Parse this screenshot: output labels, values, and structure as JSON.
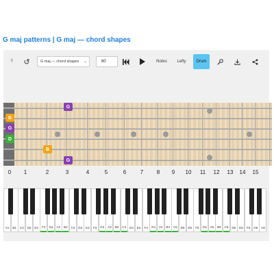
{
  "header": {
    "title": "G maj patterns | G maj — chord shapes"
  },
  "toolbar": {
    "help_label": "?",
    "select_value": "G maj — chord shapes",
    "tempo_value": "80",
    "notes_label": "Notes",
    "lefty_label": "Lefty",
    "drum_label": "Drum",
    "accent_color": "#5bc4f0"
  },
  "fretboard": {
    "fret_numbers": [
      "0",
      "1",
      "2",
      "3",
      "4",
      "5",
      "6",
      "7",
      "8",
      "9",
      "10",
      "11",
      "12",
      "13",
      "14",
      "15"
    ],
    "notes": [
      {
        "label": "G",
        "color": "#8a3fb0"
      },
      {
        "label": "B",
        "color": "#f2a416"
      },
      {
        "label": "G",
        "color": "#8a3fb0"
      },
      {
        "label": "D",
        "color": "#3bb03b"
      },
      {
        "label": "B",
        "color": "#f2a416"
      },
      {
        "label": "G",
        "color": "#8a3fb0"
      }
    ]
  },
  "keyboard": {
    "highlight_color": "#3bb03b",
    "white_keys": [
      "A1",
      "B1",
      "C2",
      "D2",
      "E2",
      "F2",
      "G2",
      "A2",
      "B2",
      "C3",
      "D3",
      "E3",
      "F3",
      "G3",
      "A3",
      "B3",
      "C4",
      "D4",
      "E4",
      "F4",
      "G4",
      "A4",
      "B4",
      "C5",
      "D5",
      "E5",
      "F5",
      "G5",
      "A5",
      "B5",
      "C6",
      "D6",
      "E6",
      "F6",
      "G6",
      "A6"
    ]
  }
}
